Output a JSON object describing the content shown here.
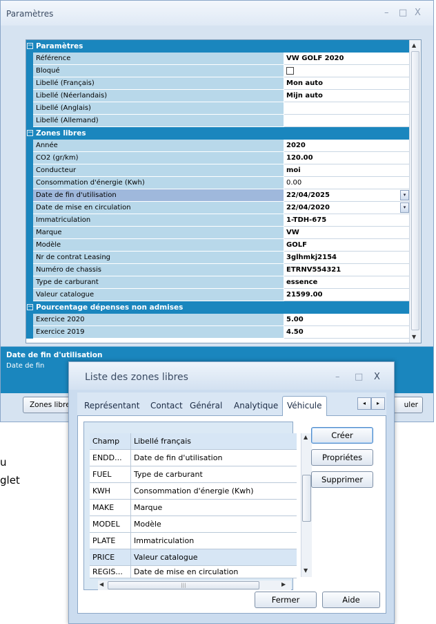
{
  "param_window": {
    "title": "Paramètres",
    "controls": {
      "minimize": "–",
      "maximize": "□",
      "close": "X"
    },
    "grid": {
      "collapse_glyph": "−",
      "dropdown_glyph": "▾",
      "categories": {
        "params": "Paramètres",
        "zones": "Zones libres",
        "pct": "Pourcentage dépenses non admises"
      },
      "rows": {
        "reference": {
          "label": "Référence",
          "value": "VW GOLF 2020"
        },
        "bloque": {
          "label": "Bloqué",
          "value": ""
        },
        "lib_fr": {
          "label": "Libellé (Français)",
          "value": "Mon auto"
        },
        "lib_nl": {
          "label": "Libellé (Néerlandais)",
          "value": "Mijn auto"
        },
        "lib_en": {
          "label": "Libellé (Anglais)",
          "value": ""
        },
        "lib_de": {
          "label": "Libellé (Allemand)",
          "value": ""
        },
        "annee": {
          "label": "Année",
          "value": "2020"
        },
        "co2": {
          "label": "CO2 (gr/km)",
          "value": "120.00"
        },
        "conducteur": {
          "label": "Conducteur",
          "value": "moi"
        },
        "conso": {
          "label": "Consommation d'énergie (Kwh)",
          "value": "0.00"
        },
        "date_fin": {
          "label": "Date de fin d'utilisation",
          "value": "22/04/2025"
        },
        "date_mise": {
          "label": "Date de mise en circulation",
          "value": "22/04/2020"
        },
        "immat": {
          "label": "Immatriculation",
          "value": "1-TDH-675"
        },
        "marque": {
          "label": "Marque",
          "value": "VW"
        },
        "modele": {
          "label": "Modèle",
          "value": "GOLF"
        },
        "contrat": {
          "label": "Nr de contrat Leasing",
          "value": "3glhmkj2154"
        },
        "chassis": {
          "label": "Numéro de chassis",
          "value": "ETRNV554321"
        },
        "carburant": {
          "label": "Type de carburant",
          "value": "essence"
        },
        "valeur": {
          "label": "Valeur catalogue",
          "value": "21599.00"
        },
        "ex2020": {
          "label": "Exercice 2020",
          "value": "5.00"
        },
        "ex2019": {
          "label": "Exercice 2019",
          "value": "4.50"
        }
      }
    },
    "description": {
      "title": "Date de fin d'utilisation",
      "text": "Date de fin"
    },
    "buttons": {
      "zones_libres": "Zones libres",
      "annuler_partial": "uler"
    }
  },
  "background_fragments": {
    "line1": "u",
    "line2": "glet"
  },
  "dialog": {
    "title": "Liste des zones libres",
    "controls": {
      "minimize": "–",
      "maximize": "□",
      "close": "X"
    },
    "tabs": {
      "representant": "Représentant",
      "contact": "Contact",
      "general": "Général",
      "analytique": "Analytique",
      "vehicule": "Véhicule"
    },
    "tab_arrows": {
      "left": "◂",
      "right": "▸"
    },
    "list": {
      "header": {
        "champ": "Champ",
        "libelle": "Libellé français"
      },
      "rows": [
        {
          "code": "ENDD...",
          "label": "Date de fin d'utilisation"
        },
        {
          "code": "FUEL",
          "label": "Type de carburant"
        },
        {
          "code": "KWH",
          "label": "Consommation d'énergie (Kwh)"
        },
        {
          "code": "MAKE",
          "label": "Marque"
        },
        {
          "code": "MODEL",
          "label": "Modèle"
        },
        {
          "code": "PLATE",
          "label": "Immatriculation"
        },
        {
          "code": "PRICE",
          "label": "Valeur catalogue"
        },
        {
          "code": "REGIS...",
          "label": "Date de mise en circulation"
        }
      ],
      "scroll_glyphs": {
        "up": "▲",
        "down": "▼",
        "left": "◀",
        "right": "▶",
        "grip": "|||"
      }
    },
    "buttons": {
      "creer": "Créer",
      "proprietes": "Propriétes",
      "supprimer": "Supprimer",
      "fermer": "Fermer",
      "aide": "Aide"
    }
  }
}
